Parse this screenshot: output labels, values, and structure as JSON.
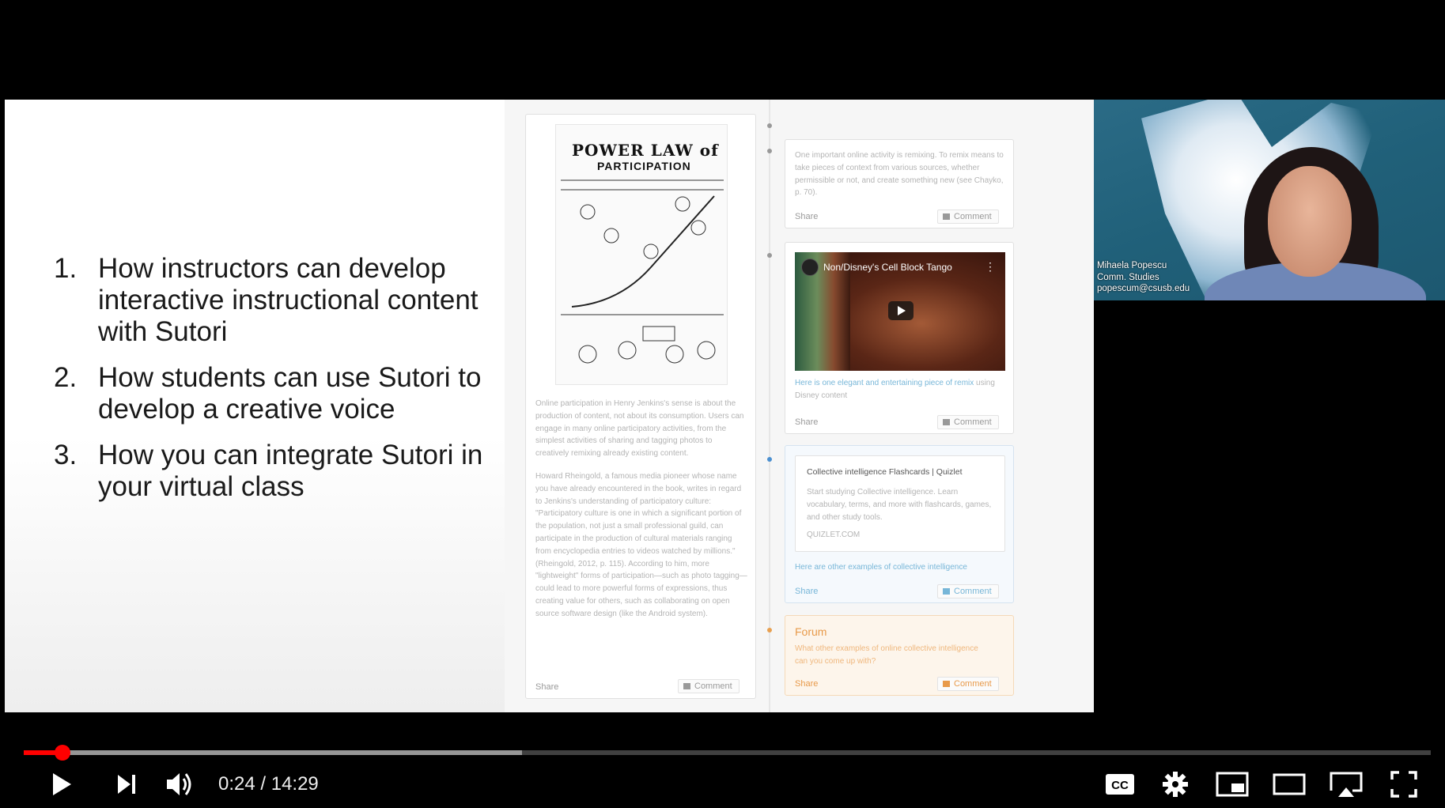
{
  "slide": {
    "agenda": [
      {
        "num": "1.",
        "text": "How instructors can develop interactive instructional content with Sutori"
      },
      {
        "num": "2.",
        "text": "How students can use Sutori to develop a creative voice"
      },
      {
        "num": "3.",
        "text": "How you can integrate Sutori in your virtual class"
      }
    ],
    "left_card": {
      "comic_title": "POWER LAW of",
      "comic_subtitle": "PARTICIPATION",
      "para1": "Online participation in Henry Jenkins's sense is about the production of content, not about its consumption. Users can engage in many online participatory activities, from the simplest activities of sharing and tagging photos to creatively remixing already existing content.",
      "para2": "Howard Rheingold, a famous media pioneer whose name you have already encountered in the book, writes in regard to Jenkins's understanding of participatory culture: \"Participatory culture is one in which a significant portion of the population, not just a small professional guild, can participate in the production of cultural materials ranging from encyclopedia entries to videos watched by millions.\" (Rheingold, 2012, p. 115). According to him, more \"lightweight\" forms of participation—such as photo tagging—could lead to more powerful forms of expressions, thus creating value for others, such as collaborating on open source software design (like the Android system).",
      "share": "Share",
      "comment": "Comment"
    },
    "card_remix": {
      "text": "One important online activity is remixing. To remix means to take pieces of context from various sources, whether permissible or not, and create something new (see Chayko, p. 70).",
      "share": "Share",
      "comment": "Comment"
    },
    "card_video": {
      "video_title": "Non/Disney's Cell Block Tango",
      "caption_link": "Here is one elegant and entertaining piece of remix",
      "caption_rest": " using Disney content",
      "share": "Share",
      "comment": "Comment"
    },
    "card_quizlet": {
      "title": "Collective intelligence Flashcards | Quizlet",
      "desc": "Start studying Collective intelligence. Learn vocabulary, terms, and more with flashcards, games, and other study tools.",
      "domain": "QUIZLET.COM",
      "link": "Here are other examples of collective intelligence",
      "share": "Share",
      "comment": "Comment"
    },
    "card_forum": {
      "title": "Forum",
      "text": "What other examples of online collective intelligence can you come up with?",
      "share": "Share",
      "comment": "Comment"
    }
  },
  "webcam": {
    "name": "Mihaela Popescu",
    "dept": "Comm. Studies",
    "email": "popescum@csusb.edu"
  },
  "player": {
    "current_time": "0:24",
    "duration": "14:29",
    "time_display": "0:24 / 14:29",
    "played_fraction": 0.0276,
    "buffered_fraction": 0.354,
    "accent_color": "#ff0000"
  },
  "icons": [
    "play-icon",
    "next-icon",
    "volume-icon",
    "captions-icon",
    "settings-icon",
    "miniplayer-icon",
    "theater-icon",
    "cast-icon",
    "fullscreen-icon"
  ]
}
